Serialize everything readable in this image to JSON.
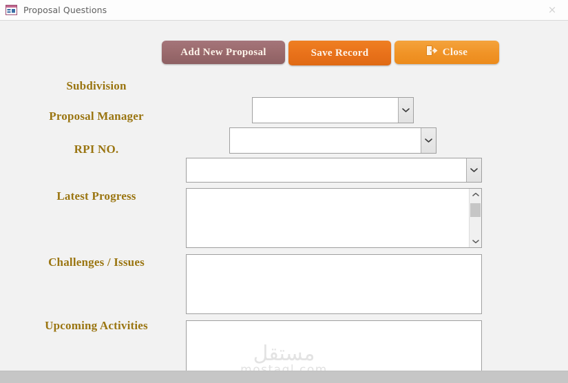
{
  "window": {
    "title": "Proposal Questions",
    "app_icon": "access-form-icon",
    "close_icon": "close-x-icon",
    "close_label": "×"
  },
  "toolbar": {
    "buttons": [
      {
        "label": "Add New Proposal",
        "name": "add-new-proposal-button",
        "color": "#9a6a6d"
      },
      {
        "label": "Save Record",
        "name": "save-record-button",
        "color": "#e8711a"
      },
      {
        "label": "Close",
        "name": "close-button",
        "color": "#f09326",
        "icon": "exit-door-icon"
      }
    ]
  },
  "form": {
    "label_color": "#9a7511",
    "fields": [
      {
        "label": "Subdivision",
        "name": "subdivision",
        "type": "combobox",
        "value": "",
        "placeholder": ""
      },
      {
        "label": "Proposal Manager",
        "name": "proposal-manager",
        "type": "combobox",
        "value": "",
        "placeholder": ""
      },
      {
        "label": "RPI NO.",
        "name": "rpi-no",
        "type": "combobox",
        "value": "",
        "placeholder": ""
      },
      {
        "label": "Latest Progress",
        "name": "latest-progress",
        "type": "textarea",
        "value": "",
        "placeholder": "",
        "scrollbar": true
      },
      {
        "label": "Challenges / Issues",
        "name": "challenges-issues",
        "type": "textarea",
        "value": "",
        "placeholder": "",
        "scrollbar": false
      },
      {
        "label": "Upcoming Activities",
        "name": "upcoming-activities",
        "type": "textarea",
        "value": "",
        "placeholder": "",
        "scrollbar": false
      }
    ]
  },
  "watermark": {
    "arabic": "مستقل",
    "latin": "mostaql.com"
  }
}
